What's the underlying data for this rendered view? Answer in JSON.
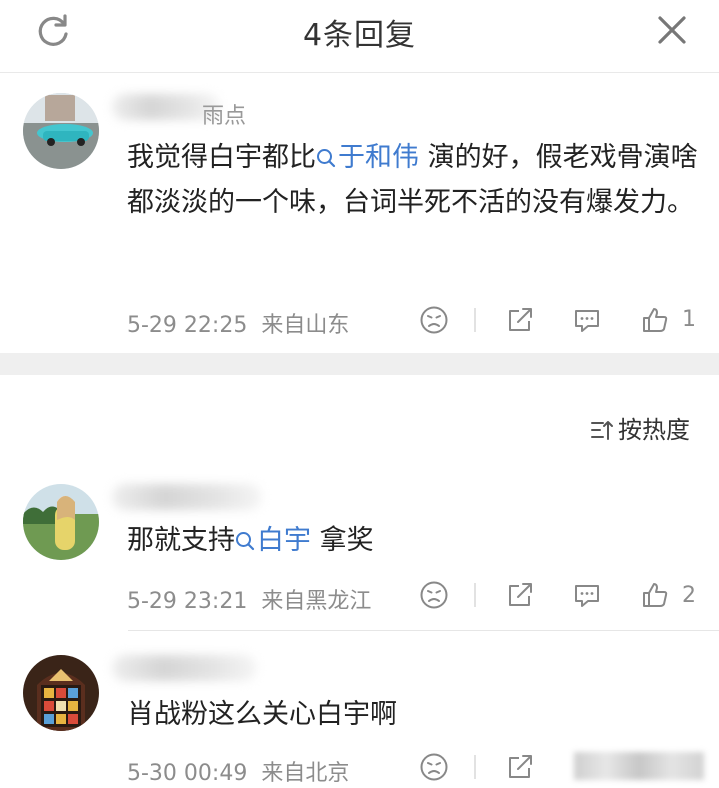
{
  "header": {
    "title": "4条回复",
    "refresh_icon": "refresh-icon",
    "close_icon": "close-icon"
  },
  "main_comment": {
    "name_suffix": "雨点",
    "text_before": "我觉得白宇都比",
    "link": "于和伟",
    "text_after": " 演的好，假老戏骨演啥都淡淡的一个味，台词半死不活的没有爆发力。",
    "time": "5-29 22:25",
    "location": "来自山东",
    "likes": "1"
  },
  "sort_label": "按热度",
  "replies": [
    {
      "text_before": "那就支持",
      "link": "白宇",
      "text_after": " 拿奖",
      "time": "5-29 23:21",
      "location": "来自黑龙江",
      "likes": "2"
    },
    {
      "text": "肖战粉这么关心白宇啊",
      "time": "5-30 00:49",
      "location": "来自北京"
    }
  ],
  "colors": {
    "link": "#3f7bcf",
    "meta": "#8c8c8c",
    "divider": "#efefef"
  }
}
